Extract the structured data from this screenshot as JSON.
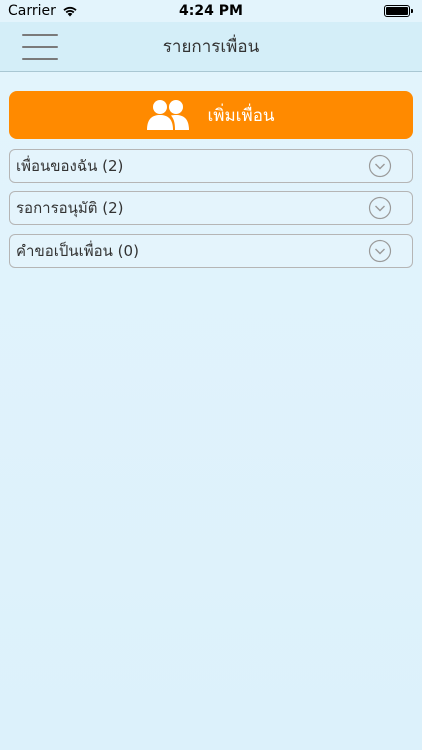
{
  "status": {
    "carrier": "Carrier",
    "time": "4:24 PM"
  },
  "nav": {
    "title": "รายการเพื่อน"
  },
  "add_button": {
    "label": "เพิ่มเพื่อน"
  },
  "sections": [
    {
      "label": "เพื่อนของฉัน (2)"
    },
    {
      "label": "รอการอนุมัติ (2)"
    },
    {
      "label": "คำขอเป็นเพื่อน (0)"
    }
  ],
  "colors": {
    "accent": "#ff8a00",
    "background": "#dcf0fb",
    "navbar": "#d4eef8"
  }
}
